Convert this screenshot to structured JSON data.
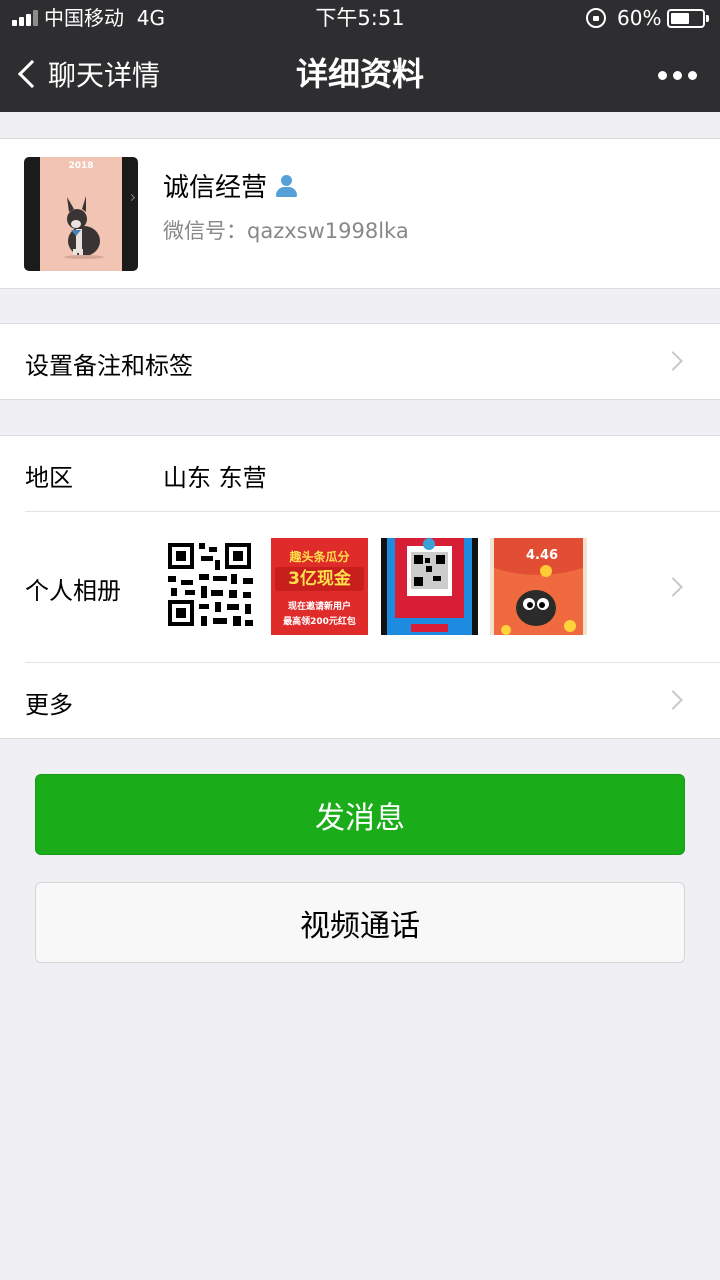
{
  "status_bar": {
    "carrier": "中国移动",
    "network": "4G",
    "time": "下午5:51",
    "battery": "60%",
    "battery_level": 0.6
  },
  "nav": {
    "back_label": "聊天详情",
    "title": "详细资料"
  },
  "profile": {
    "name": "诚信经营",
    "wechat_id_label": "微信号：",
    "wechat_id": "qazxsw1998lka",
    "avatar_year": "2018"
  },
  "remark_row": {
    "label": "设置备注和标签"
  },
  "region_row": {
    "label": "地区",
    "value": "山东 东营"
  },
  "album_row": {
    "label": "个人相册",
    "photos": [
      {
        "kind": "qr-code"
      },
      {
        "kind": "promo-banner",
        "line1": "趣头条瓜分",
        "line2": "3亿现金",
        "line3": "现在邀请新用户",
        "line4": "最高领200元红包"
      },
      {
        "kind": "qr-poster"
      },
      {
        "kind": "red-envelope",
        "amount": "4.46"
      }
    ]
  },
  "more_row": {
    "label": "更多"
  },
  "actions": {
    "message": "发消息",
    "video_call": "视频通话"
  },
  "colors": {
    "nav_bg": "#2e2e31",
    "primary_green": "#1aad19",
    "page_bg": "#efeff4"
  }
}
